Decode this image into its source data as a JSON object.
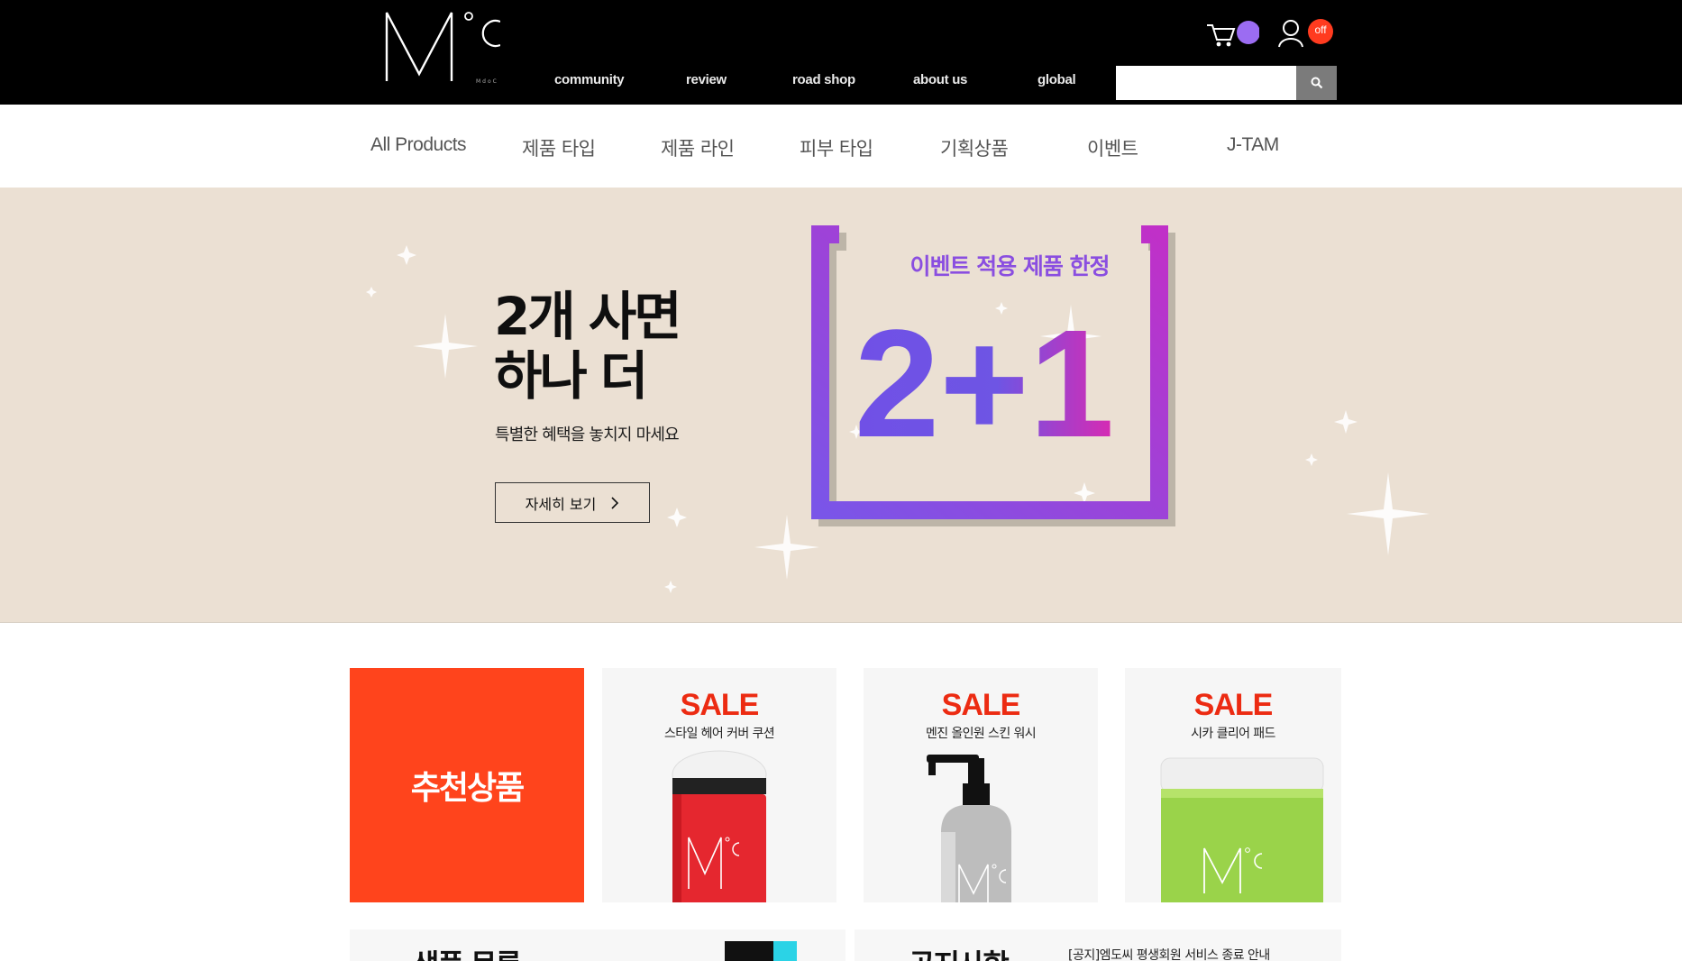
{
  "brand": {
    "logo_text": "M°C",
    "logo_sub": "MdoC"
  },
  "header": {
    "nav": [
      "community",
      "review",
      "road shop",
      "about us",
      "global"
    ],
    "cart_icon": "cart-icon",
    "user_icon": "user-icon",
    "user_badge": "off",
    "search": {
      "value": "",
      "placeholder": ""
    },
    "search_icon": "search-icon"
  },
  "categories": [
    "All Products",
    "제품 타입",
    "제품 라인",
    "피부 타입",
    "기획상품",
    "이벤트",
    "J-TAM"
  ],
  "banner": {
    "headline_line1": "2개 사면",
    "headline_line2": "하나 더",
    "subtitle": "특별한 혜택을 놓치지 마세요",
    "button_label": "자세히 보기",
    "promo_caption": "이벤트 적용 제품 한정",
    "promo_text": "2+1",
    "colors": {
      "background": "#ebe0d3",
      "purple": "#7a55e8",
      "magenta": "#d62bb4"
    }
  },
  "recommended": {
    "title": "추천상품",
    "products": [
      {
        "badge": "SALE",
        "name": "스타일 헤어 커버 쿠션"
      },
      {
        "badge": "SALE",
        "name": "멘진 올인원 스킨 워시"
      },
      {
        "badge": "SALE",
        "name": "시카 클리어 패드"
      }
    ]
  },
  "bottom": {
    "left_title": "샘플 목록",
    "right_title": "공지사항",
    "notice": "[공지]엠도씨 평생회원 서비스 종료 안내"
  },
  "colors": {
    "topbar": "#000000",
    "accent_orange": "#ff441c",
    "sale_red": "#ec2b12",
    "cart_dot": "#9b6cf2",
    "off_badge": "#ff3b1f"
  }
}
